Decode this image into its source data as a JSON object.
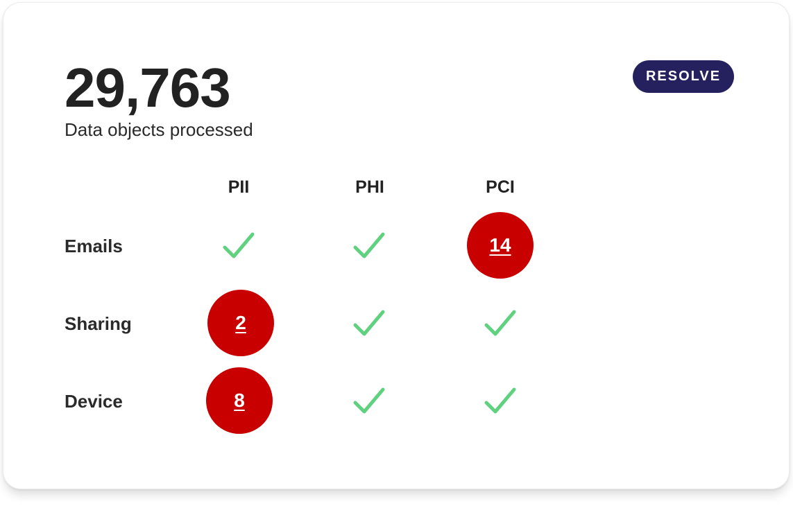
{
  "summary": {
    "count": "29,763",
    "label": "Data objects processed"
  },
  "actions": {
    "resolve_label": "RESOLVE"
  },
  "columns": [
    "PII",
    "PHI",
    "PCI"
  ],
  "rows": [
    {
      "label": "Emails",
      "cells": [
        {
          "status": "ok"
        },
        {
          "status": "ok"
        },
        {
          "status": "issue",
          "count": "14"
        }
      ]
    },
    {
      "label": "Sharing",
      "cells": [
        {
          "status": "issue",
          "count": "2"
        },
        {
          "status": "ok"
        },
        {
          "status": "ok"
        }
      ]
    },
    {
      "label": "Device",
      "cells": [
        {
          "status": "issue",
          "count": "8"
        },
        {
          "status": "ok"
        },
        {
          "status": "ok"
        }
      ]
    }
  ],
  "colors": {
    "accent": "#25205e",
    "issue": "#c80000",
    "ok": "#5fd17f",
    "text": "#222222"
  },
  "icons": {
    "ok": "check-icon"
  }
}
